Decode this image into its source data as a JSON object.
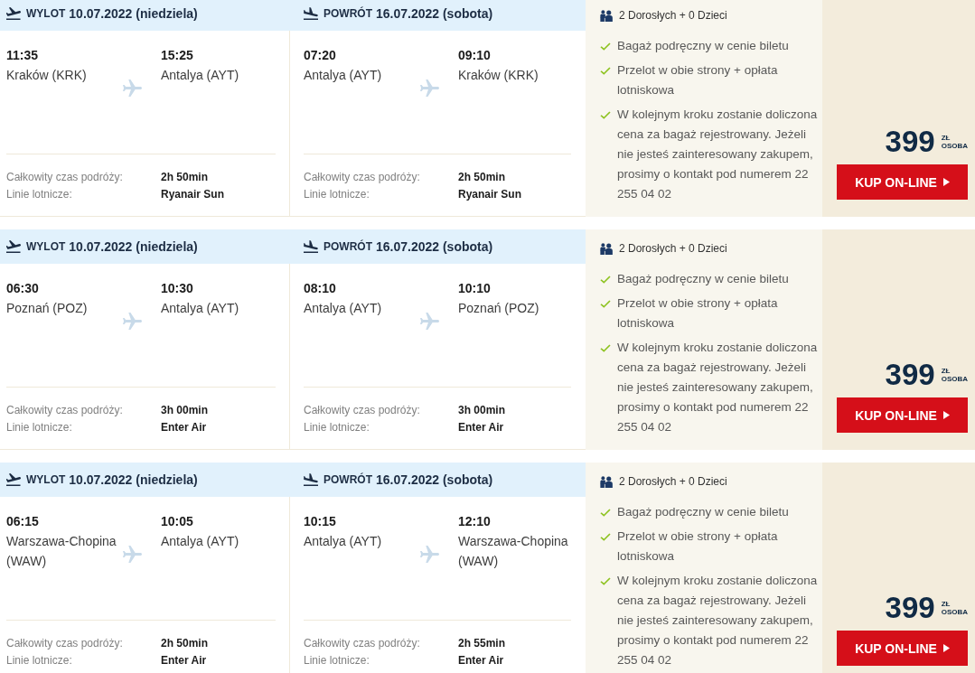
{
  "offers": [
    {
      "legs": [
        {
          "kind": "outbound",
          "label": "WYLOT",
          "date": "10.07.2022 (niedziela)",
          "departure": {
            "time": "11:35",
            "place": "Kraków (KRK)"
          },
          "arrival": {
            "time": "15:25",
            "place": "Antalya (AYT)"
          },
          "duration_label": "Całkowity czas podróży:",
          "duration": "2h 50min",
          "airline_label": "Linie lotnicze:",
          "airline": "Ryanair Sun"
        },
        {
          "kind": "return",
          "label": "POWRÓT",
          "date": "16.07.2022 (sobota)",
          "departure": {
            "time": "07:20",
            "place": "Antalya (AYT)"
          },
          "arrival": {
            "time": "09:10",
            "place": "Kraków (KRK)"
          },
          "duration_label": "Całkowity czas podróży:",
          "duration": "2h 50min",
          "airline_label": "Linie lotnicze:",
          "airline": "Ryanair Sun"
        }
      ],
      "passengers": "2 Dorosłych + 0 Dzieci",
      "features": [
        "Bagaż podręczny w cenie biletu",
        "Przelot w obie strony + opłata lotniskowa",
        "W kolejnym kroku zostanie doliczona cena za bagaż rejestrowany. Jeżeli nie jesteś zainteresowany zakupem, prosimy o kontakt pod numerem 22 255 04 02"
      ],
      "price": "399",
      "currency": "ZŁ",
      "per": "OSOBA",
      "button": "KUP ON-LINE"
    },
    {
      "legs": [
        {
          "kind": "outbound",
          "label": "WYLOT",
          "date": "10.07.2022 (niedziela)",
          "departure": {
            "time": "06:30",
            "place": "Poznań (POZ)"
          },
          "arrival": {
            "time": "10:30",
            "place": "Antalya (AYT)"
          },
          "duration_label": "Całkowity czas podróży:",
          "duration": "3h 00min",
          "airline_label": "Linie lotnicze:",
          "airline": "Enter Air"
        },
        {
          "kind": "return",
          "label": "POWRÓT",
          "date": "16.07.2022 (sobota)",
          "departure": {
            "time": "08:10",
            "place": "Antalya (AYT)"
          },
          "arrival": {
            "time": "10:10",
            "place": "Poznań (POZ)"
          },
          "duration_label": "Całkowity czas podróży:",
          "duration": "3h 00min",
          "airline_label": "Linie lotnicze:",
          "airline": "Enter Air"
        }
      ],
      "passengers": "2 Dorosłych + 0 Dzieci",
      "features": [
        "Bagaż podręczny w cenie biletu",
        "Przelot w obie strony + opłata lotniskowa",
        "W kolejnym kroku zostanie doliczona cena za bagaż rejestrowany. Jeżeli nie jesteś zainteresowany zakupem, prosimy o kontakt pod numerem 22 255 04 02"
      ],
      "price": "399",
      "currency": "ZŁ",
      "per": "OSOBA",
      "button": "KUP ON-LINE"
    },
    {
      "legs": [
        {
          "kind": "outbound",
          "label": "WYLOT",
          "date": "10.07.2022 (niedziela)",
          "departure": {
            "time": "06:15",
            "place": "Warszawa-Chopina (WAW)"
          },
          "arrival": {
            "time": "10:05",
            "place": "Antalya (AYT)"
          },
          "duration_label": "Całkowity czas podróży:",
          "duration": "2h 50min",
          "airline_label": "Linie lotnicze:",
          "airline": "Enter Air"
        },
        {
          "kind": "return",
          "label": "POWRÓT",
          "date": "16.07.2022 (sobota)",
          "departure": {
            "time": "10:15",
            "place": "Antalya (AYT)"
          },
          "arrival": {
            "time": "12:10",
            "place": "Warszawa-Chopina (WAW)"
          },
          "duration_label": "Całkowity czas podróży:",
          "duration": "2h 55min",
          "airline_label": "Linie lotnicze:",
          "airline": "Enter Air"
        }
      ],
      "passengers": "2 Dorosłych + 0 Dzieci",
      "features": [
        "Bagaż podręczny w cenie biletu",
        "Przelot w obie strony + opłata lotniskowa",
        "W kolejnym kroku zostanie doliczona cena za bagaż rejestrowany. Jeżeli nie jesteś zainteresowany zakupem, prosimy o kontakt pod numerem 22 255 04 02"
      ],
      "price": "399",
      "currency": "ZŁ",
      "per": "OSOBA",
      "button": "KUP ON-LINE"
    }
  ]
}
